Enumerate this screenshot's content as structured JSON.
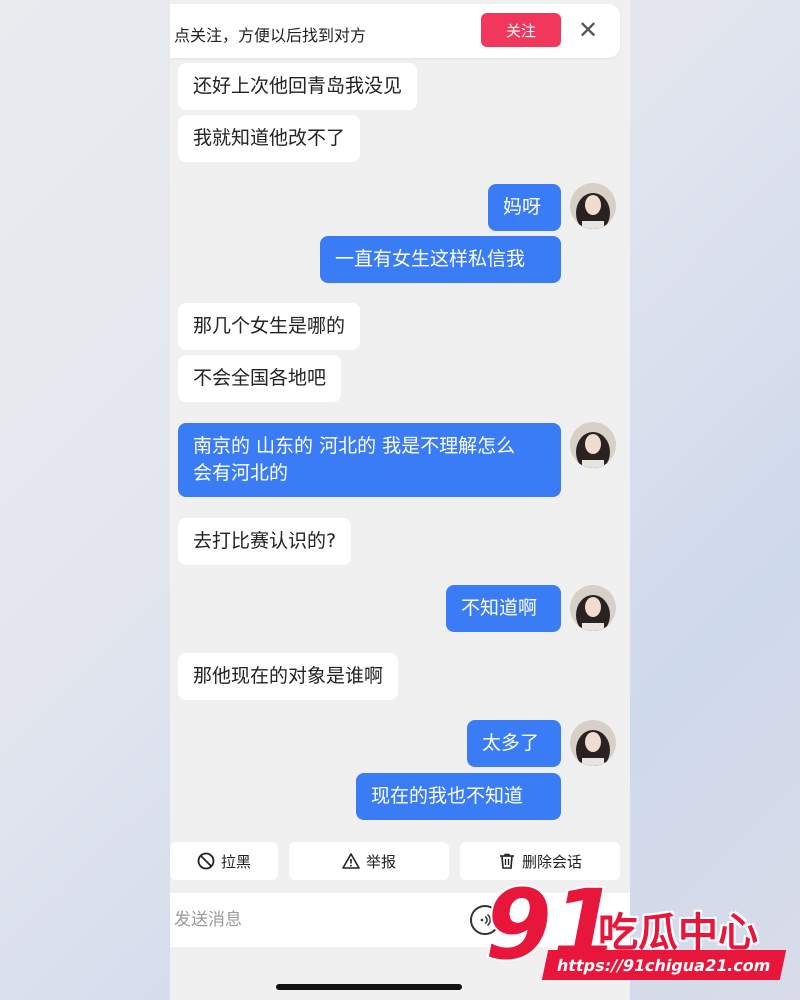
{
  "follow_bar": {
    "text": "点关注，方便以后找到对方",
    "follow_label": "关注",
    "close_label": "✕"
  },
  "messages": [
    {
      "side": "in",
      "text": "还好上次他回青岛我没见"
    },
    {
      "side": "in",
      "text": "我就知道他改不了"
    },
    {
      "side": "out",
      "text": "妈呀"
    },
    {
      "side": "out",
      "text": "一直有女生这样私信我"
    },
    {
      "side": "in",
      "text": "那几个女生是哪的"
    },
    {
      "side": "in",
      "text": "不会全国各地吧"
    },
    {
      "side": "out",
      "text": "南京的 山东的 河北的 我是不理解怎么",
      "text2": "会有河北的"
    },
    {
      "side": "in",
      "text": "去打比赛认识的?"
    },
    {
      "side": "out",
      "text": "不知道啊"
    },
    {
      "side": "in",
      "text": "那他现在的对象是谁啊"
    },
    {
      "side": "out",
      "text": "太多了"
    },
    {
      "side": "out",
      "text": "现在的我也不知道"
    }
  ],
  "actions": {
    "block": "拉黑",
    "report": "举报",
    "delete": "删除会话"
  },
  "input": {
    "placeholder": "发送消息"
  },
  "watermark": {
    "number": "91",
    "name": "吃瓜中心",
    "url": "https://91chigua21.com"
  },
  "colors": {
    "outgoing_bubble": "#3a7cf5",
    "follow_button": "#f1385c",
    "watermark": "#e8163b"
  }
}
